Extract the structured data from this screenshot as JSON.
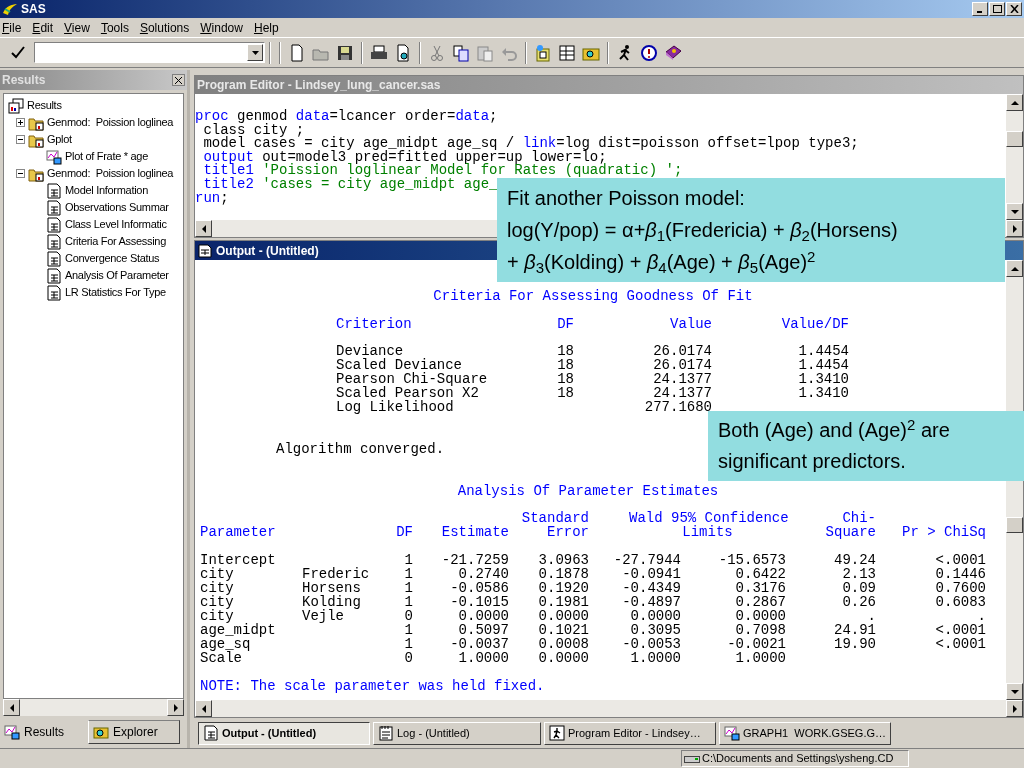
{
  "app": {
    "title": "SAS"
  },
  "menu": [
    "File",
    "Edit",
    "View",
    "Tools",
    "Solutions",
    "Window",
    "Help"
  ],
  "results_panel": {
    "title": "Results",
    "tree": [
      {
        "label": "Results",
        "kind": "results",
        "children": [
          {
            "label": "Genmod:  Poission loglinea",
            "kind": "folder",
            "expanded": false
          },
          {
            "label": "Gplot",
            "kind": "folder",
            "expanded": true,
            "children": [
              {
                "label": "Plot of Frate * age",
                "kind": "graph"
              }
            ]
          },
          {
            "label": "Genmod:  Poission loglinea",
            "kind": "folder",
            "expanded": true,
            "children": [
              {
                "label": "Model Information",
                "kind": "table"
              },
              {
                "label": "Observations Summar",
                "kind": "table"
              },
              {
                "label": "Class Level Informatic",
                "kind": "table"
              },
              {
                "label": "Criteria For Assessing",
                "kind": "table"
              },
              {
                "label": "Convergence Status",
                "kind": "table"
              },
              {
                "label": "Analysis Of Parameter",
                "kind": "table"
              },
              {
                "label": "LR Statistics For Type",
                "kind": "table"
              }
            ]
          }
        ]
      }
    ],
    "tabs": [
      {
        "label": "Results",
        "selected": true
      },
      {
        "label": "Explorer",
        "selected": false
      }
    ]
  },
  "program_editor": {
    "title": "Program Editor - Lindsey_lung_cancer.sas",
    "code": [
      [
        {
          "kind": "keyword",
          "text": "proc"
        },
        {
          "kind": "plain",
          "text": " genmod "
        },
        {
          "kind": "keyword",
          "text": "data"
        },
        {
          "kind": "plain",
          "text": "=lcancer order="
        },
        {
          "kind": "keyword",
          "text": "data"
        },
        {
          "kind": "plain",
          "text": ";"
        }
      ],
      [
        {
          "kind": "plain",
          "text": " class city ;"
        }
      ],
      [
        {
          "kind": "plain",
          "text": " model cases = city age_midpt age_sq / "
        },
        {
          "kind": "keyword",
          "text": "link"
        },
        {
          "kind": "plain",
          "text": "=log dist=poisson offset=lpop type3;"
        }
      ],
      [
        {
          "kind": "keyword",
          "text": " output"
        },
        {
          "kind": "plain",
          "text": " out=model3 pred=fitted upper=up lower=lo;"
        }
      ],
      [
        {
          "kind": "keyword",
          "text": " title1"
        },
        {
          "kind": "string",
          "text": " 'Poission loglinear Model for Rates (quadratic) ';"
        }
      ],
      [
        {
          "kind": "keyword",
          "text": " title2"
        },
        {
          "kind": "string",
          "text": " 'cases = city age_midpt age_"
        }
      ],
      [
        {
          "kind": "keyword",
          "text": "run"
        },
        {
          "kind": "plain",
          "text": ";"
        }
      ]
    ]
  },
  "output_window": {
    "title": "Output - (Untitled)",
    "criteria": {
      "title": "Criteria For Assessing Goodness Of Fit",
      "columns": [
        "Criterion",
        "DF",
        "Value",
        "Value/DF"
      ],
      "rows": [
        {
          "criterion": "Deviance",
          "df": "18",
          "value": "26.0174",
          "value_df": "1.4454"
        },
        {
          "criterion": "Scaled Deviance",
          "df": "18",
          "value": "26.0174",
          "value_df": "1.4454"
        },
        {
          "criterion": "Pearson Chi-Square",
          "df": "18",
          "value": "24.1377",
          "value_df": "1.3410"
        },
        {
          "criterion": "Scaled Pearson X2",
          "df": "18",
          "value": "24.1377",
          "value_df": "1.3410"
        },
        {
          "criterion": "Log Likelihood",
          "value": "277.1680"
        }
      ]
    },
    "message": "Algorithm converged.",
    "estimates": {
      "title": "Analysis Of Parameter Estimates",
      "columns": {
        "parameter": [
          "Parameter"
        ],
        "df": [
          "DF"
        ],
        "estimate": [
          "Estimate"
        ],
        "std_error": [
          "Standard",
          "Error"
        ],
        "confidence_limits": [
          "Wald 95% Confidence",
          "Limits"
        ],
        "chi_square": [
          "Chi-",
          "Square"
        ],
        "pr": [
          "Pr > ChiSq"
        ]
      },
      "rows": [
        {
          "parameter": "Intercept",
          "df": "1",
          "estimate": "-21.7259",
          "std_error": "3.0963",
          "lower": "-27.7944",
          "upper": "-15.6573",
          "chi_square": "49.24",
          "pr": "<.0001"
        },
        {
          "parameter": "city",
          "level": "Frederic",
          "df": "1",
          "estimate": "0.2740",
          "std_error": "0.1878",
          "lower": "-0.0941",
          "upper": "0.6422",
          "chi_square": "2.13",
          "pr": "0.1446"
        },
        {
          "parameter": "city",
          "level": "Horsens",
          "df": "1",
          "estimate": "-0.0586",
          "std_error": "0.1920",
          "lower": "-0.4349",
          "upper": "0.3176",
          "chi_square": "0.09",
          "pr": "0.7600"
        },
        {
          "parameter": "city",
          "level": "Kolding",
          "df": "1",
          "estimate": "-0.1015",
          "std_error": "0.1981",
          "lower": "-0.4897",
          "upper": "0.2867",
          "chi_square": "0.26",
          "pr": "0.6083"
        },
        {
          "parameter": "city",
          "level": "Vejle",
          "df": "0",
          "estimate": "0.0000",
          "std_error": "0.0000",
          "lower": "0.0000",
          "upper": "0.0000",
          "chi_square": ".",
          "pr": "."
        },
        {
          "parameter": "age_midpt",
          "df": "1",
          "estimate": "0.5097",
          "std_error": "0.1021",
          "lower": "0.3095",
          "upper": "0.7098",
          "chi_square": "24.91",
          "pr": "<.0001"
        },
        {
          "parameter": "age_sq",
          "df": "1",
          "estimate": "-0.0037",
          "std_error": "0.0008",
          "lower": "-0.0053",
          "upper": "-0.0021",
          "chi_square": "19.90",
          "pr": "<.0001"
        },
        {
          "parameter": "Scale",
          "df": "0",
          "estimate": "1.0000",
          "std_error": "0.0000",
          "lower": "1.0000",
          "upper": "1.0000"
        }
      ]
    },
    "note": "NOTE: The scale parameter was held fixed."
  },
  "window_tabs": [
    {
      "label": "Output - (Untitled)",
      "kind": "output",
      "selected": true
    },
    {
      "label": "Log - (Untitled)",
      "kind": "log",
      "selected": false
    },
    {
      "label": "Program Editor - Lindsey…",
      "kind": "editor",
      "selected": false
    },
    {
      "label": "GRAPH1  WORK.GSEG.G…",
      "kind": "graph",
      "selected": false
    }
  ],
  "status_bar": {
    "path": "C:\\Documents and Settings\\ysheng.CD"
  },
  "callouts": [
    {
      "lines": [
        "Fit another Poisson model:",
        "log(Y/pop) = α+*β*$_{1}$(Fredericia) + *β*$_{2}$(Horsens)",
        "+ *β*$_{3}$(Kolding) + *β*$_{4}$(Age) + *β*$_{5}$(Age)$^{2}$"
      ]
    },
    {
      "lines": [
        "Both (Age) and (Age)$^{2}$ are significant predictors."
      ]
    }
  ]
}
